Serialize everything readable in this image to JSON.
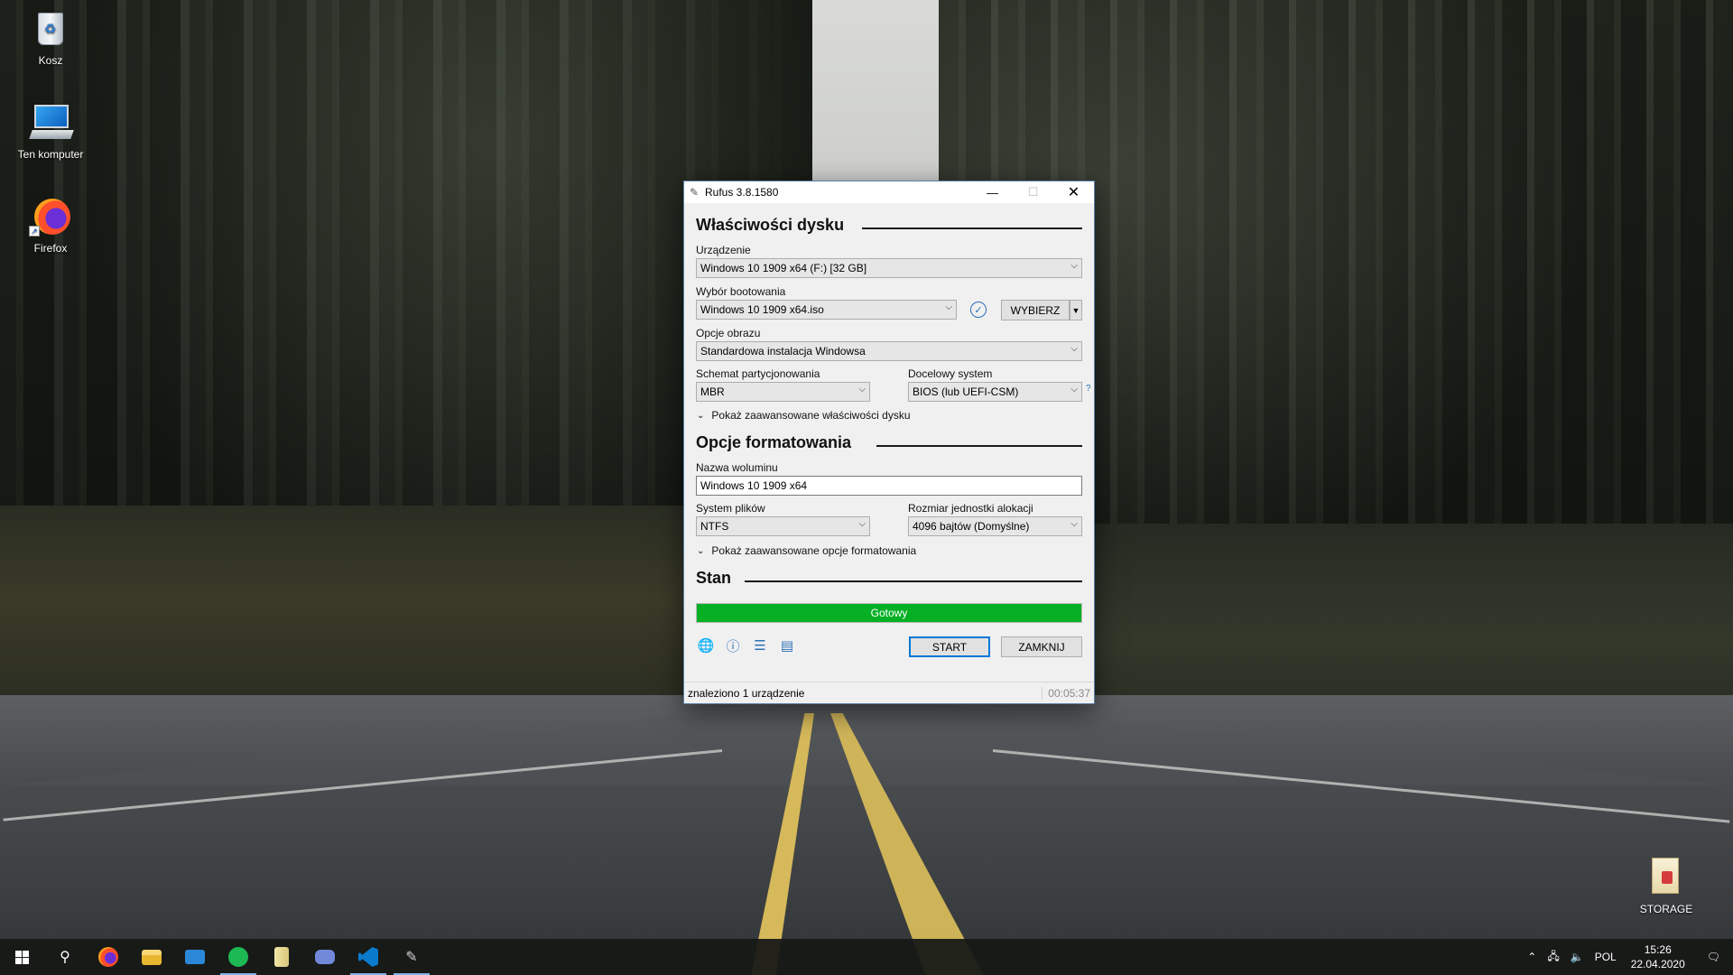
{
  "desktop": {
    "icons": [
      {
        "label": "Kosz"
      },
      {
        "label": "Ten komputer"
      },
      {
        "label": "Firefox"
      }
    ],
    "storage_label": "STORAGE"
  },
  "window": {
    "title": "Rufus 3.8.1580",
    "disk_section": {
      "heading": "Właściwości dysku",
      "device_label": "Urządzenie",
      "device_value": "Windows 10 1909 x64 (F:) [32 GB]",
      "boot_label": "Wybór bootowania",
      "boot_value": "Windows 10 1909 x64.iso",
      "select_button": "WYBIERZ",
      "image_option_label": "Opcje obrazu",
      "image_option_value": "Standardowa instalacja Windowsa",
      "partition_label": "Schemat partycjonowania",
      "partition_value": "MBR",
      "target_label": "Docelowy system",
      "target_value": "BIOS (lub UEFI-CSM)",
      "help_mark": "?",
      "advanced_toggle": "Pokaż zaawansowane właściwości dysku"
    },
    "format_section": {
      "heading": "Opcje formatowania",
      "volume_label": "Nazwa woluminu",
      "volume_value": "Windows 10 1909 x64",
      "fs_label": "System plików",
      "fs_value": "NTFS",
      "cluster_label": "Rozmiar jednostki alokacji",
      "cluster_value": "4096 bajtów (Domyślne)",
      "advanced_toggle": "Pokaż zaawansowane opcje formatowania"
    },
    "status_section": {
      "heading": "Stan",
      "progress_text": "Gotowy",
      "progress_fraction": 1.0,
      "progress_color": "#06b025"
    },
    "buttons": {
      "start": "START",
      "close": "ZAMKNIJ"
    },
    "statusbar": {
      "left": "znaleziono 1 urządzenie",
      "right": "00:05:37"
    }
  },
  "taskbar": {
    "apps": [
      "firefox-icon",
      "file-explorer-icon",
      "mail-icon",
      "spotify-icon",
      "notepad-icon",
      "discord-icon",
      "vscode-icon",
      "rufus-icon"
    ],
    "language": "POL",
    "time": "15:26",
    "date": "22.04.2020"
  }
}
